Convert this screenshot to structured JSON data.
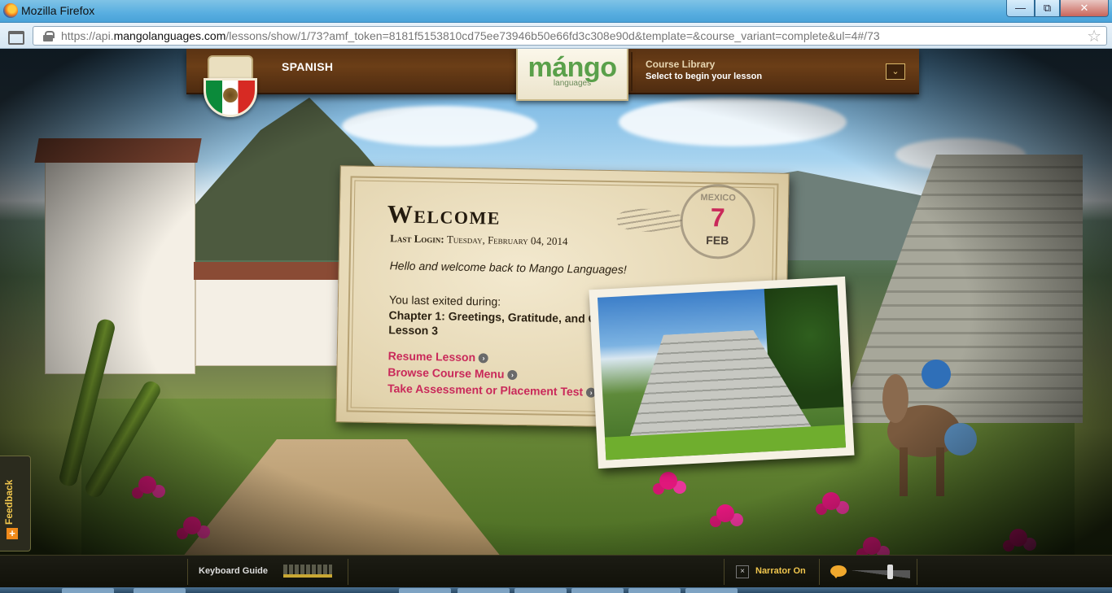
{
  "browser": {
    "title": "Mozilla Firefox",
    "url_prefix": "https://api.",
    "url_domain": "mangolanguages.com",
    "url_rest": "/lessons/show/1/73?amf_token=8181f5153810cd75ee73946b50e66fd3c308e90d&template=&course_variant=complete&ul=4#/73",
    "minimize": "—",
    "maximize": "⧉",
    "close": "✕",
    "bookmark_star": "☆"
  },
  "header": {
    "language": "SPANISH",
    "logo_text": "mángo",
    "logo_sub": "languages",
    "library_title": "Course Library",
    "library_subtitle": "Select to begin your lesson",
    "dropdown_glyph": "⌄"
  },
  "welcome": {
    "title": "Welcome",
    "last_login_label": "Last Login:",
    "last_login_value": "Tuesday, February 04, 2014",
    "greeting": "Hello and welcome back to Mango Languages!",
    "exit_label": "You last exited during:",
    "exit_chapter": "Chapter 1: Greetings, Gratitude, and C",
    "exit_lesson": "Lesson 3",
    "links": {
      "resume": "Resume Lesson",
      "browse": "Browse Course Menu",
      "assess": "Take Assessment or Placement Test"
    },
    "arrow_glyph": "›",
    "postmark": {
      "country": "MEXICO",
      "day": "7",
      "month": "FEB"
    }
  },
  "feedback": {
    "label": "Feedback",
    "plus": "+"
  },
  "bottom": {
    "keyboard_guide": "Keyboard Guide",
    "narrator_toggle": "×",
    "narrator_label": "Narrator On"
  },
  "colors": {
    "link": "#c9295a",
    "logo_green": "#5aa04a",
    "narrator": "#f0c64d"
  }
}
